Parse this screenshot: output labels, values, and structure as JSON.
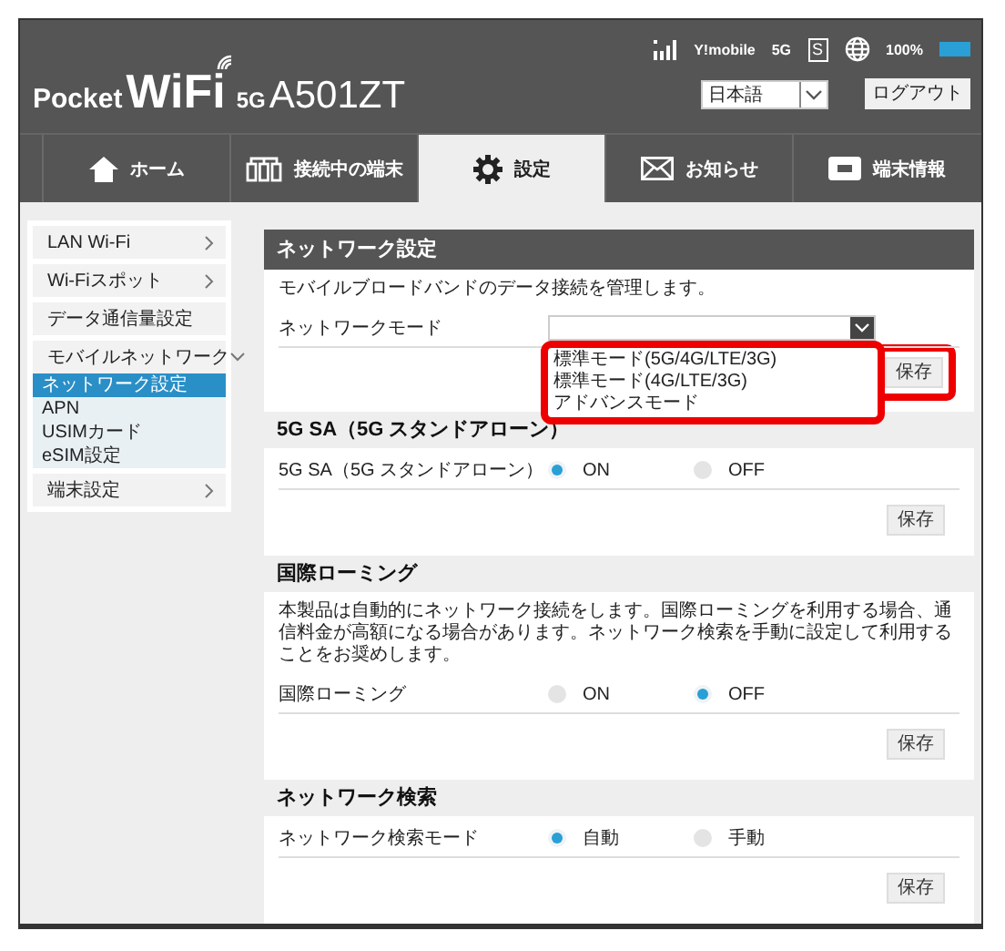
{
  "header": {
    "logo_prefix": "Pocket",
    "logo_main": "WiFi",
    "logo_badge": "5G",
    "model": "A501ZT",
    "carrier": "Y!mobile",
    "network": "5G",
    "sim": "S",
    "battery": "100%",
    "language": "日本語",
    "logout": "ログアウト"
  },
  "tabs": [
    {
      "label": "ホーム",
      "selected": false
    },
    {
      "label": "接続中の端末",
      "selected": false
    },
    {
      "label": "設定",
      "selected": true
    },
    {
      "label": "お知らせ",
      "selected": false
    },
    {
      "label": "端末情報",
      "selected": false
    }
  ],
  "sidebar": {
    "items": [
      {
        "label": "LAN Wi-Fi",
        "kind": "group",
        "expanded": false
      },
      {
        "label": "Wi-Fiスポット",
        "kind": "group",
        "expanded": false
      },
      {
        "label": "データ通信量設定",
        "kind": "link"
      },
      {
        "label": "モバイルネットワーク",
        "kind": "group",
        "expanded": true,
        "children": [
          {
            "label": "ネットワーク設定",
            "selected": true
          },
          {
            "label": "APN",
            "selected": false
          },
          {
            "label": "USIMカード",
            "selected": false
          },
          {
            "label": "eSIM設定",
            "selected": false
          }
        ]
      },
      {
        "label": "端末設定",
        "kind": "group",
        "expanded": false
      }
    ]
  },
  "sections": [
    {
      "title": "ネットワーク設定",
      "kind": "dark",
      "description": "モバイルブロードバンドのデータ接続を管理します。",
      "rows": [
        {
          "kind": "select",
          "label": "ネットワークモード",
          "open": true,
          "highlighted": true,
          "options": [
            "標準モード(5G/4G/LTE/3G)",
            "標準モード(4G/LTE/3G)",
            "アドバンスモード"
          ]
        }
      ],
      "save": {
        "label": "保存",
        "highlighted": true
      }
    },
    {
      "title": "5G SA（5G スタンドアローン）",
      "kind": "light",
      "rows": [
        {
          "kind": "radio",
          "label": "5G SA（5G スタンドアローン）",
          "options": [
            {
              "label": "ON",
              "selected": true
            },
            {
              "label": "OFF",
              "selected": false
            }
          ]
        }
      ],
      "save": {
        "label": "保存"
      }
    },
    {
      "title": "国際ローミング",
      "kind": "light",
      "description": "本製品は自動的にネットワーク接続をします。国際ローミングを利用する場合、通信料金が高額になる場合があります。ネットワーク検索を手動に設定して利用することをお奨めします。",
      "rows": [
        {
          "kind": "radio",
          "label": "国際ローミング",
          "options": [
            {
              "label": "ON",
              "selected": false
            },
            {
              "label": "OFF",
              "selected": true
            }
          ]
        }
      ],
      "save": {
        "label": "保存"
      }
    },
    {
      "title": "ネットワーク検索",
      "kind": "light",
      "rows": [
        {
          "kind": "radio",
          "label": "ネットワーク検索モード",
          "options": [
            {
              "label": "自動",
              "selected": true
            },
            {
              "label": "手動",
              "selected": false
            }
          ]
        }
      ],
      "save": {
        "label": "保存"
      }
    }
  ]
}
